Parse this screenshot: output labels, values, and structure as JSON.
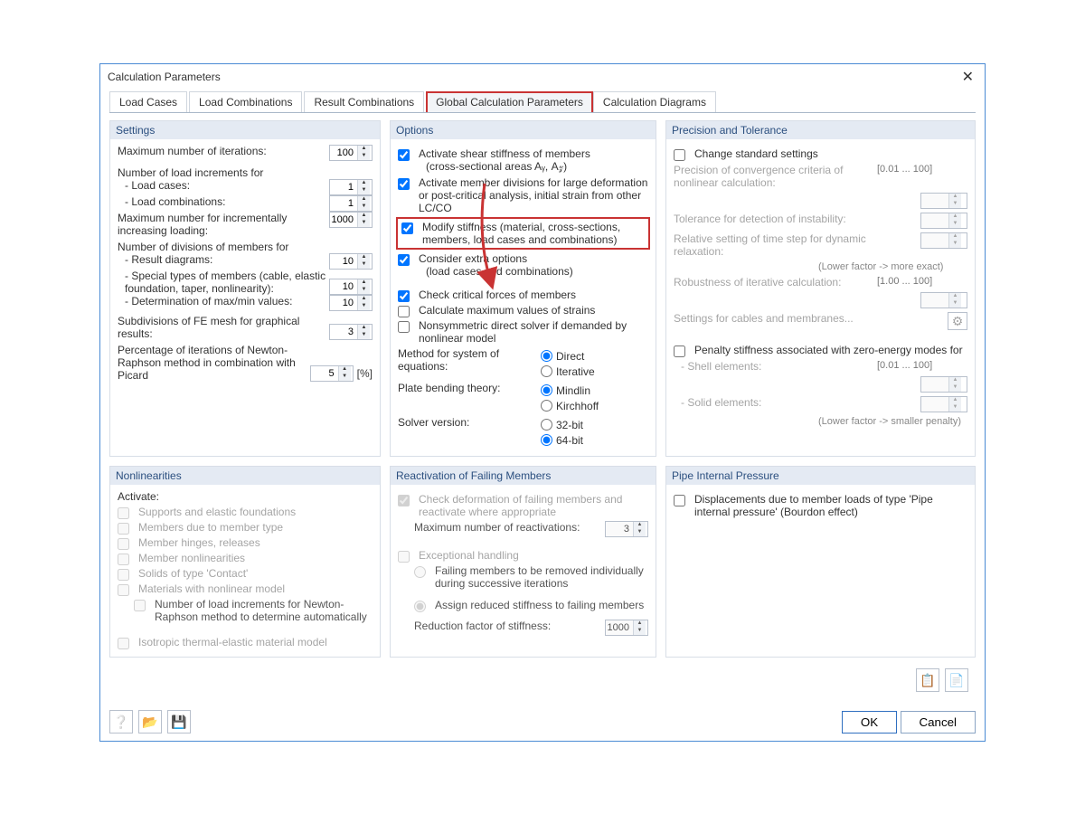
{
  "dialog": {
    "title": "Calculation Parameters"
  },
  "tabs": {
    "t1": "Load Cases",
    "t2": "Load Combinations",
    "t3": "Result Combinations",
    "t4": "Global Calculation Parameters",
    "t5": "Calculation Diagrams"
  },
  "settings": {
    "header": "Settings",
    "max_iter_label": "Maximum number of iterations:",
    "max_iter": "100",
    "num_incr_label": "Number of load increments for",
    "load_cases_label": "- Load cases:",
    "load_cases": "1",
    "load_combos_label": "- Load combinations:",
    "load_combos": "1",
    "max_incr_load_label": "Maximum number for incrementally increasing loading:",
    "max_incr_load": "1000",
    "div_members_label": "Number of divisions of members for",
    "result_diag_label": "- Result diagrams:",
    "result_diag": "10",
    "special_types_label": "- Special types of members (cable, elastic foundation, taper, nonlinearity):",
    "special_types": "10",
    "det_maxmin_label": "- Determination of max/min values:",
    "det_maxmin": "10",
    "subdiv_label": "Subdivisions of FE mesh for graphical results:",
    "subdiv": "3",
    "pct_label": "Percentage of iterations of Newton-Raphson method in combination with Picard",
    "pct": "5",
    "pct_unit": "[%]"
  },
  "options": {
    "header": "Options",
    "shear": "Activate shear stiffness of members",
    "shear_sub": "(cross-sectional areas Aᵧ, A𝓏)",
    "member_div": "Activate member divisions for large deformation or post-critical analysis, initial strain from other LC/CO",
    "modify": "Modify stiffness (material, cross-sections, members, load cases and combinations)",
    "extra": "Consider extra options",
    "extra_sub": "(load cases and combinations)",
    "crit": "Check critical forces of members",
    "maxstrain": "Calculate maximum values of strains",
    "nonsym": "Nonsymmetric direct solver if demanded by nonlinear model",
    "method_label": "Method for system of equations:",
    "m_direct": "Direct",
    "m_iter": "Iterative",
    "plate_label": "Plate bending theory:",
    "p_mindlin": "Mindlin",
    "p_kirch": "Kirchhoff",
    "solver_label": "Solver version:",
    "s_32": "32-bit",
    "s_64": "64-bit"
  },
  "precision": {
    "header": "Precision and Tolerance",
    "change": "Change standard settings",
    "conv_label": "Precision of convergence criteria of nonlinear calculation:",
    "range1": "[0.01 ... 100]",
    "instab_label": "Tolerance for detection of instability:",
    "relax_label": "Relative setting of time step for dynamic relaxation:",
    "hint1": "(Lower factor -> more exact)",
    "robust_label": "Robustness of iterative calculation:",
    "range2": "[1.00 ... 100]",
    "cables": "Settings for cables and membranes...",
    "penalty": "Penalty stiffness associated with zero-energy modes for",
    "shell_label": "- Shell elements:",
    "solid_label": "- Solid elements:",
    "range3": "[0.01 ... 100]",
    "hint2": "(Lower factor -> smaller penalty)"
  },
  "nonlin": {
    "header": "Nonlinearities",
    "activate": "Activate:",
    "c1": "Supports and elastic foundations",
    "c2": "Members due to member type",
    "c3": "Member hinges, releases",
    "c4": "Member nonlinearities",
    "c5": "Solids of type 'Contact'",
    "c6": "Materials with nonlinear model",
    "c6sub": "Number of load increments for Newton-Raphson method to determine automatically",
    "c7": "Isotropic thermal-elastic material model"
  },
  "react": {
    "header": "Reactivation of Failing Members",
    "check": "Check deformation of failing members and reactivate where appropriate",
    "max_label": "Maximum number of reactivations:",
    "max": "3",
    "except": "Exceptional handling",
    "r1": "Failing members to be removed individually during successive iterations",
    "r2": "Assign reduced stiffness to failing members",
    "reduc_label": "Reduction factor of stiffness:",
    "reduc": "1000"
  },
  "pipe": {
    "header": "Pipe Internal Pressure",
    "disp": "Displacements due to member loads of type 'Pipe internal pressure' (Bourdon effect)"
  },
  "buttons": {
    "ok": "OK",
    "cancel": "Cancel"
  }
}
